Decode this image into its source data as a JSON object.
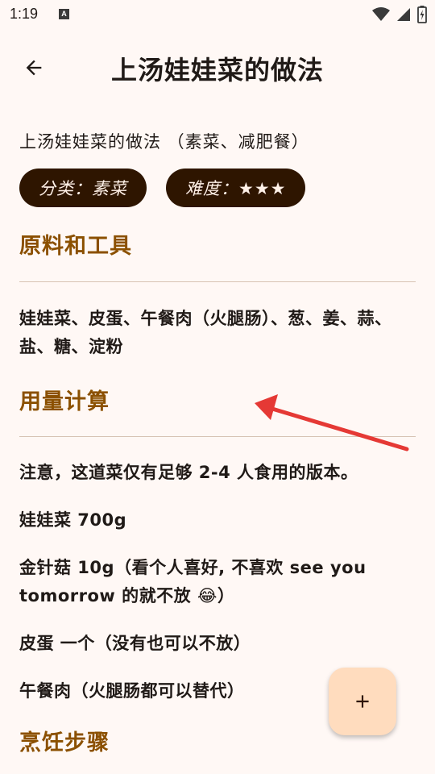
{
  "status": {
    "time": "1:19",
    "notification_glyph": "A"
  },
  "header": {
    "title": "上汤娃娃菜的做法",
    "back_icon": "arrow-left-icon"
  },
  "recipe": {
    "subtitle": "上汤娃娃菜的做法 （素菜、减肥餐）",
    "chips": {
      "category": "分类：素菜",
      "difficulty": "难度：★★★"
    }
  },
  "sections": {
    "ingredients": {
      "title": "原料和工具",
      "text": "娃娃菜、皮蛋、午餐肉（火腿肠）、葱、姜、蒜、盐、糖、淀粉"
    },
    "quantities": {
      "title": "用量计算",
      "note": "注意，这道菜仅有足够 2-4 人食用的版本。",
      "items": [
        "娃娃菜 700g",
        "金针菇 10g（看个人喜好, 不喜欢 see you tomorrow 的就不放 😂）",
        "皮蛋 一个（没有也可以不放）",
        "午餐肉（火腿肠都可以替代）"
      ]
    },
    "steps": {
      "title": "烹饪步骤"
    }
  },
  "fab": {
    "icon": "plus-icon"
  },
  "colors": {
    "background": "#FFF8F5",
    "section_title": "#8B5000",
    "chip_bg": "#2E1500",
    "fab_bg": "#FFDCBE",
    "annotation_arrow": "#E53935"
  }
}
